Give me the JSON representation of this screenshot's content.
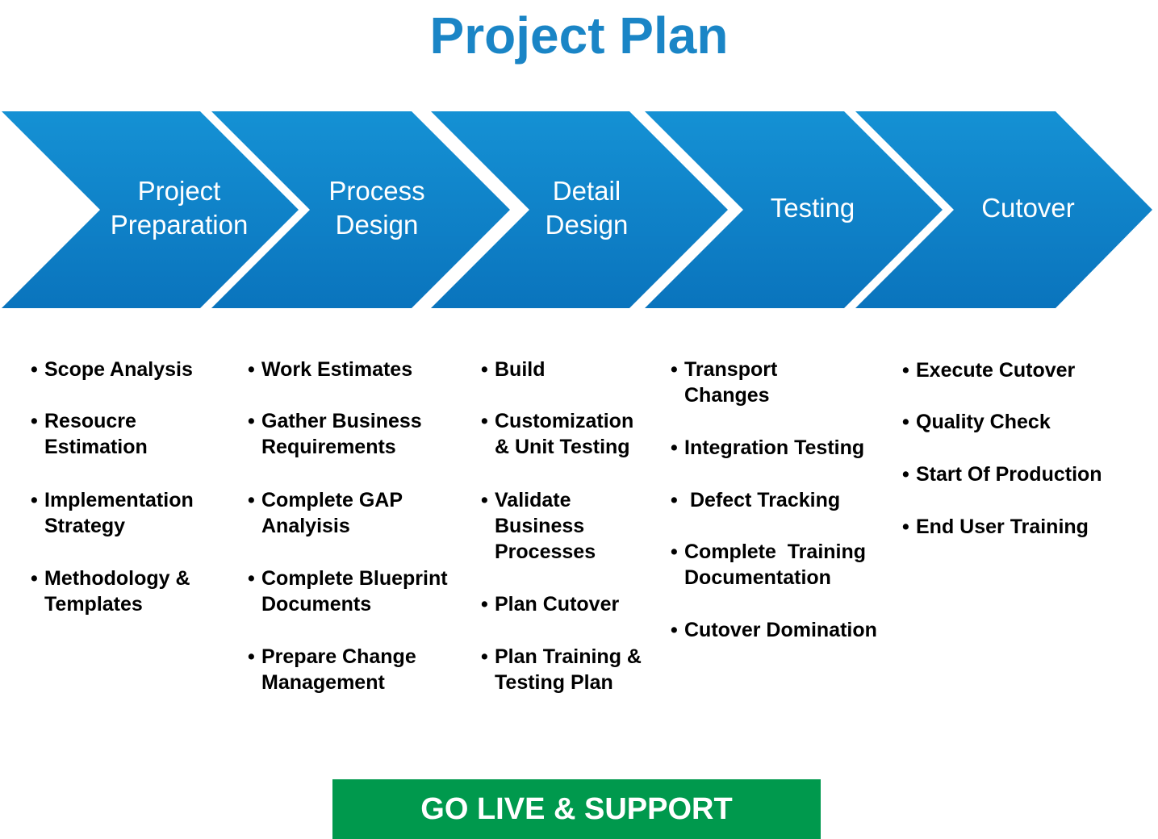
{
  "title": "Project Plan",
  "colors": {
    "title": "#1a85c6",
    "chevron_top": "#1591d4",
    "chevron_bottom": "#0a74bd",
    "golive": "#00994d"
  },
  "phases": [
    {
      "label": "Project\nPreparation",
      "tasks": [
        "Scope Analysis",
        "Resoucre\nEstimation",
        "Implementation\nStrategy",
        "Methodology &\nTemplates"
      ]
    },
    {
      "label": "Process\nDesign",
      "tasks": [
        "Work Estimates",
        "Gather Business\nRequirements",
        "Complete GAP\nAnalyisis",
        "Complete Blueprint\nDocuments",
        "Prepare Change\nManagement"
      ]
    },
    {
      "label": "Detail\nDesign",
      "tasks": [
        "Build",
        "Customization\n& Unit Testing",
        "Validate\nBusiness\nProcesses",
        "Plan Cutover",
        "Plan Training &\nTesting Plan"
      ]
    },
    {
      "label": "Testing",
      "tasks": [
        "Transport\nChanges",
        "Integration Testing",
        " Defect Tracking",
        "Complete  Training\nDocumentation",
        "Cutover Domination"
      ]
    },
    {
      "label": "Cutover",
      "tasks": [
        "Execute Cutover",
        "Quality Check",
        "Start Of Production",
        "End User Training"
      ]
    }
  ],
  "bullet": "•",
  "golive_label": "GO LIVE & SUPPORT"
}
